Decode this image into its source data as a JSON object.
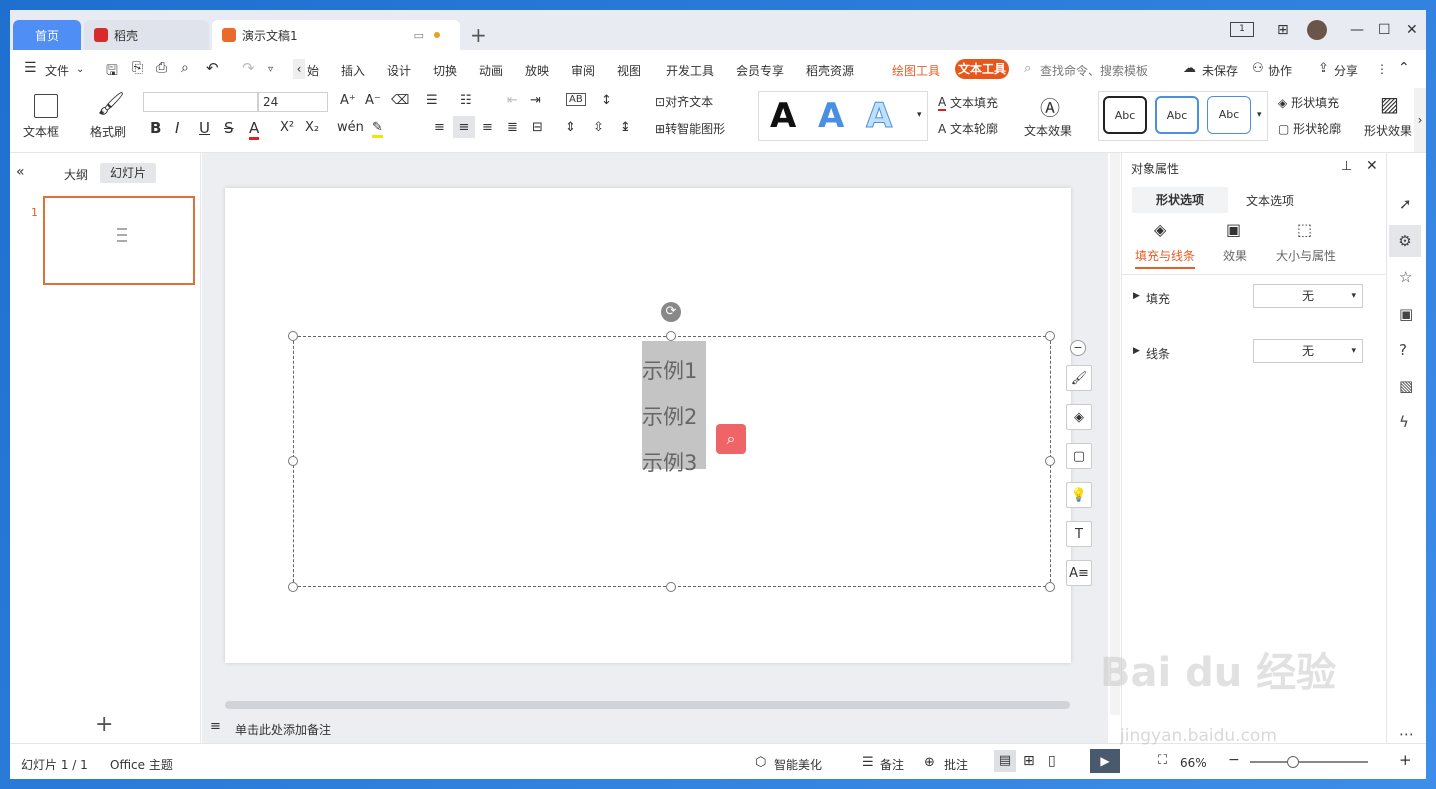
{
  "tabs": {
    "home": "首页",
    "doc1": "稻壳",
    "doc2": "演示文稿1",
    "new_tab": "+"
  },
  "menu": {
    "file": "文件",
    "start": "始",
    "insert": "插入",
    "design": "设计",
    "transition": "切换",
    "animation": "动画",
    "slideshow": "放映",
    "review": "审阅",
    "view": "视图",
    "devtools": "开发工具",
    "member": "会员专享",
    "docer": "稻壳资源",
    "drawtool": "绘图工具",
    "texttool": "文本工具",
    "search": "查找命令、搜索模板",
    "unsaved": "未保存",
    "collab": "协作",
    "share": "分享"
  },
  "toolbar": {
    "textbox": "文本框",
    "format_painter": "格式刷",
    "font_size": "24",
    "align_text": "对齐文本",
    "smart_shape": "转智能图形",
    "text_fill": "文本填充",
    "text_outline": "文本轮廓",
    "text_effect": "文本效果",
    "shape_fill": "形状填充",
    "shape_outline": "形状轮廓",
    "shape_effect": "形状效果",
    "style_abc": "Abc",
    "big_a": "A"
  },
  "left": {
    "outline_tab": "大纲",
    "slides_tab": "幻灯片",
    "slide_num": "1"
  },
  "slide": {
    "lines": [
      "示例1",
      "示例2",
      "示例3"
    ]
  },
  "notes": {
    "placeholder": "单击此处添加备注"
  },
  "props": {
    "title": "对象属性",
    "tab_shape": "形状选项",
    "tab_text": "文本选项",
    "sub_fill_line": "填充与线条",
    "sub_effect": "效果",
    "sub_size": "大小与属性",
    "fill_label": "填充",
    "fill_value": "无",
    "line_label": "线条",
    "line_value": "无"
  },
  "status": {
    "slide_info": "幻灯片 1 / 1",
    "theme": "Office 主题",
    "beautify": "智能美化",
    "notes": "备注",
    "comment": "批注",
    "zoom": "66%"
  },
  "watermark": {
    "brand": "Bai du 经验",
    "url": "jingyan.baidu.com"
  },
  "colors": {
    "accent": "#e8561a",
    "tab_blue": "#4f8ef5",
    "selection": "#c4c4c4"
  }
}
